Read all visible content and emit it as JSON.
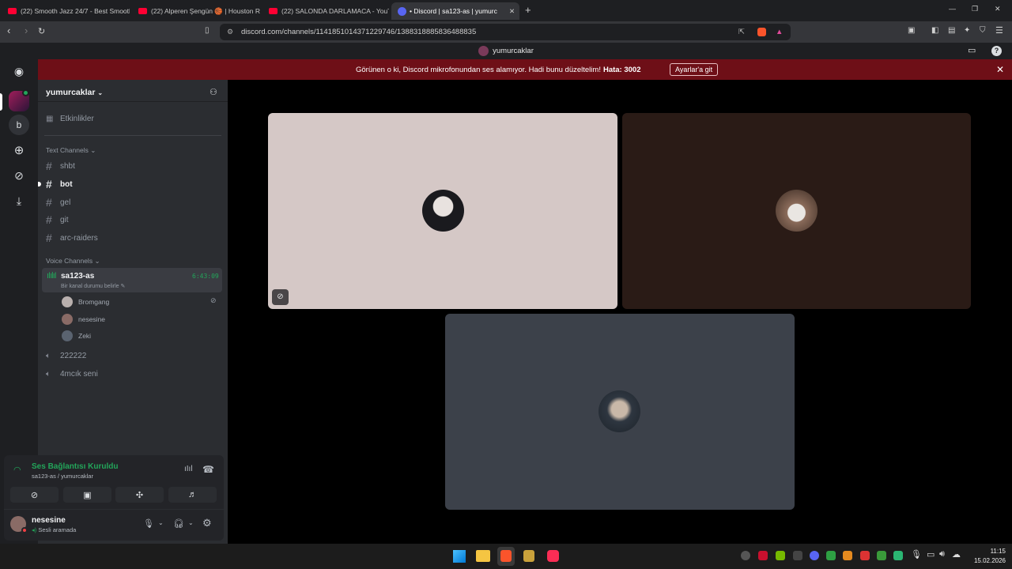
{
  "browser": {
    "tabs": [
      {
        "label": "(22) Smooth Jazz 24/7 - Best Smooth",
        "type": "youtube"
      },
      {
        "label": "(22) Alperen Şengün 🏀 | Houston R",
        "type": "youtube"
      },
      {
        "label": "(22) SALONDA DARLAMACA - YouTu",
        "type": "youtube"
      },
      {
        "label": "• Discord | sa123-as | yumurc",
        "type": "discord"
      }
    ],
    "url": "discord.com/channels/1141851014371229746/1388318885836488835",
    "new_tab": "+",
    "win_min": "—",
    "win_restore": "❐",
    "win_close": "✕"
  },
  "app": {
    "title": "yumurcaklar"
  },
  "banner": {
    "message": "Görünen o ki, Discord mikrofonundan ses alamıyor. Hadi bunu düzeltelim!",
    "error": "Hata: 3002",
    "button": "Ayarlar'a git"
  },
  "rail": {
    "b_label": "b"
  },
  "server": {
    "name": "yumurcaklar",
    "events": "Etkinlikler",
    "text_category": "Text Channels",
    "text_channels": [
      "shbt",
      "bot",
      "gel",
      "git",
      "arc-raiders"
    ],
    "voice_category": "Voice Channels",
    "active_voice": {
      "name": "sa123-as",
      "timer": "6:43:09",
      "status": "Bir kanal durumu belirle"
    },
    "voice_users": [
      "Bromgang",
      "nesesine",
      "Zeki"
    ],
    "other_voice": [
      "222222",
      "4mcık seni"
    ]
  },
  "voice_panel": {
    "status": "Ses Bağlantısı Kuruldu",
    "location": "sa123-as / yumurcaklar",
    "username": "nesesine",
    "user_status": "Sesli aramada"
  },
  "tiles": [
    {
      "bg": "#d5c8c6",
      "muted": true
    },
    {
      "bg": "#2a1b16",
      "muted": false
    },
    {
      "bg": "#3c414a",
      "muted": false
    }
  ],
  "taskbar": {
    "time": "11:15",
    "date": "15.02.2026"
  },
  "colors": {
    "green": "#23a55a",
    "banner": "#6e0f17",
    "accent": "#5865f2"
  }
}
